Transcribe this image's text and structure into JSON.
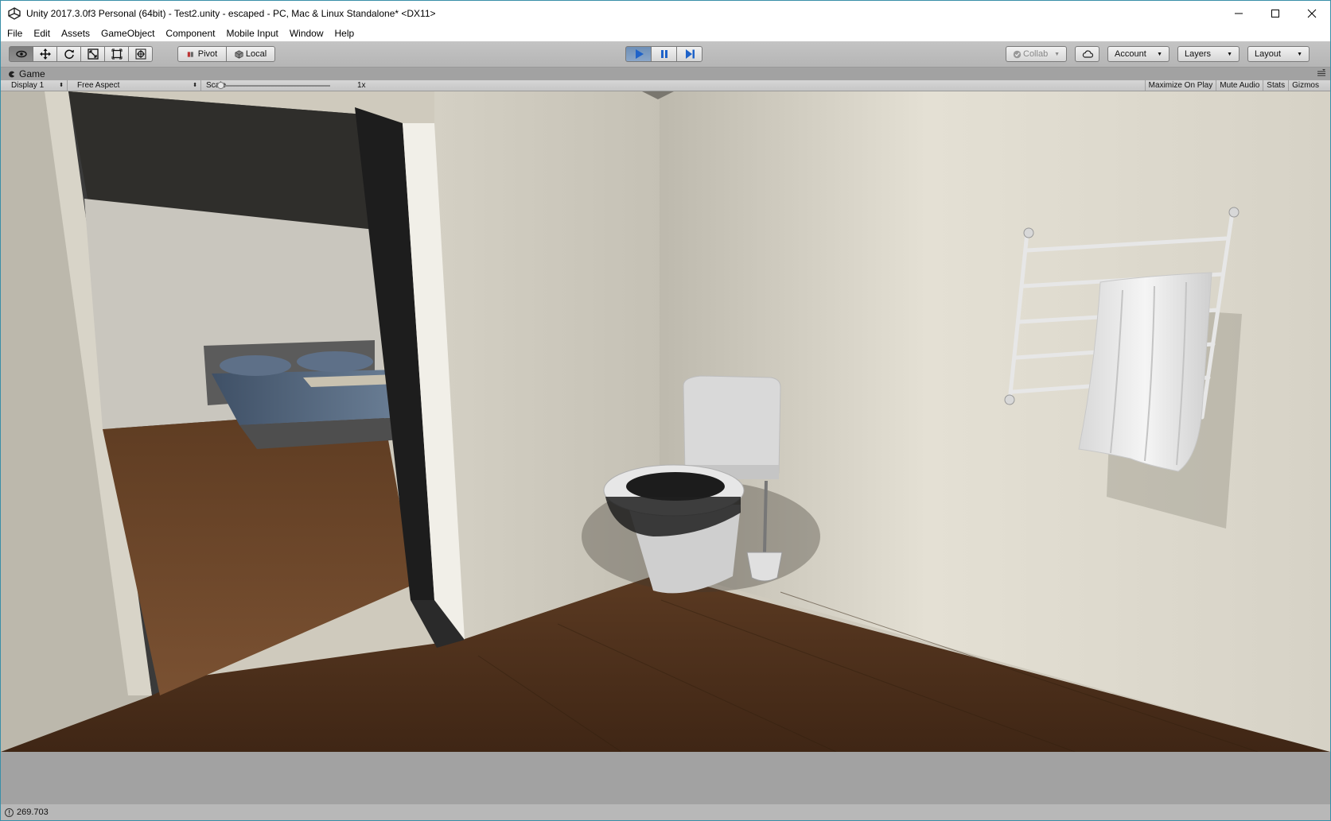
{
  "window": {
    "title": "Unity 2017.3.0f3 Personal (64bit) - Test2.unity - escaped - PC, Mac & Linux Standalone* <DX11>"
  },
  "menu": [
    "File",
    "Edit",
    "Assets",
    "GameObject",
    "Component",
    "Mobile Input",
    "Window",
    "Help"
  ],
  "toolbar": {
    "transform_tools": [
      "hand-tool",
      "move-tool",
      "rotate-tool",
      "scale-tool",
      "rect-tool",
      "transform-tool"
    ],
    "active_tool": "hand-tool",
    "pivot_label": "Pivot",
    "local_label": "Local",
    "collab_label": "Collab",
    "account_label": "Account",
    "layers_label": "Layers",
    "layout_label": "Layout",
    "play_state": "playing"
  },
  "game_panel": {
    "tab_label": "Game",
    "display": "Display 1",
    "aspect": "Free Aspect",
    "scale_label": "Scale",
    "scale_value": "1x",
    "buttons": [
      "Maximize On Play",
      "Mute Audio",
      "Stats",
      "Gizmos"
    ]
  },
  "status": {
    "message": "269.703"
  },
  "colors": {
    "play_active": "#3d6aa8",
    "window_border": "#3a8fa8"
  }
}
